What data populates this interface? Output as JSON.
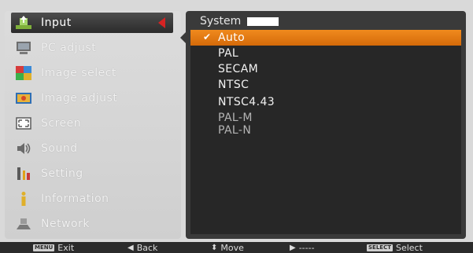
{
  "left_menu": {
    "items": [
      {
        "label": "Input",
        "icon": "input-icon"
      },
      {
        "label": "PC adjust",
        "icon": "pc-adjust-icon"
      },
      {
        "label": "Image select",
        "icon": "image-select-icon"
      },
      {
        "label": "Image adjust",
        "icon": "image-adjust-icon"
      },
      {
        "label": "Screen",
        "icon": "screen-icon"
      },
      {
        "label": "Sound",
        "icon": "sound-icon"
      },
      {
        "label": "Setting",
        "icon": "setting-icon"
      },
      {
        "label": "Information",
        "icon": "information-icon"
      },
      {
        "label": "Network",
        "icon": "network-icon"
      }
    ],
    "selected_index": 0
  },
  "panel": {
    "title": "System",
    "options": [
      {
        "label": "Auto",
        "state": "selected"
      },
      {
        "label": "PAL",
        "state": "normal"
      },
      {
        "label": "SECAM",
        "state": "normal"
      },
      {
        "label": "NTSC",
        "state": "normal"
      },
      {
        "label": "NTSC4.43",
        "state": "normal"
      },
      {
        "label": "PAL-M",
        "state": "disabled"
      },
      {
        "label": "PAL-N",
        "state": "disabled"
      }
    ]
  },
  "status_bar": {
    "exit_key": "MENU",
    "exit_label": "Exit",
    "back_glyph": "◀",
    "back_label": "Back",
    "move_glyph": "⬍",
    "move_label": "Move",
    "next_glyph": "▶",
    "next_label": "-----",
    "select_key": "SELECT",
    "select_label": "Select"
  },
  "colors": {
    "selected_option": "#e67e14",
    "selected_menu": "#3a3a3a",
    "panel_bg": "#3a3a3a",
    "menu_arrow": "#d62323"
  }
}
